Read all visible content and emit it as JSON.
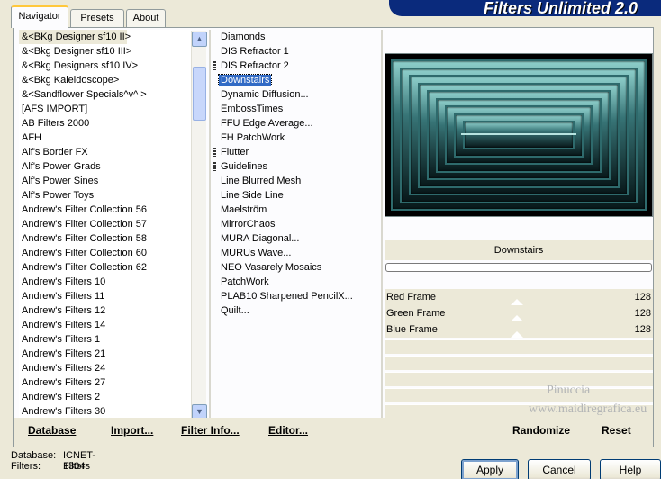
{
  "app": {
    "title": "Filters Unlimited 2.0"
  },
  "tabs": [
    {
      "label": "Navigator"
    },
    {
      "label": "Presets"
    },
    {
      "label": "About"
    }
  ],
  "categories": [
    "&<BKg Designer sf10 II>",
    "&<Bkg Designer sf10 III>",
    "&<Bkg Designers sf10 IV>",
    "&<Bkg Kaleidoscope>",
    "&<Sandflower Specials^v^ >",
    "[AFS IMPORT]",
    "AB Filters 2000",
    "AFH",
    "Alf's Border FX",
    "Alf's Power Grads",
    "Alf's Power Sines",
    "Alf's Power Toys",
    "Andrew's Filter Collection 56",
    "Andrew's Filter Collection 57",
    "Andrew's Filter Collection 58",
    "Andrew's Filter Collection 60",
    "Andrew's Filter Collection 62",
    "Andrew's Filters 10",
    "Andrew's Filters 11",
    "Andrew's Filters 12",
    "Andrew's Filters 14",
    "Andrew's Filters 1",
    "Andrew's Filters 21",
    "Andrew's Filters 24",
    "Andrew's Filters 27",
    "Andrew's Filters 2",
    "Andrew's Filters 30"
  ],
  "filters": [
    {
      "label": "Diamonds"
    },
    {
      "label": "DIS Refractor 1"
    },
    {
      "label": "DIS Refractor 2",
      "grip": true
    },
    {
      "label": "Downstairs",
      "selected": true
    },
    {
      "label": "Dynamic Diffusion..."
    },
    {
      "label": "EmbossTimes"
    },
    {
      "label": "FFU Edge Average..."
    },
    {
      "label": "FH PatchWork"
    },
    {
      "label": "Flutter",
      "grip": true
    },
    {
      "label": "Guidelines",
      "grip": true
    },
    {
      "label": "Line Blurred Mesh"
    },
    {
      "label": "Line Side Line"
    },
    {
      "label": "Maelström"
    },
    {
      "label": "MirrorChaos"
    },
    {
      "label": "MURA Diagonal..."
    },
    {
      "label": "MURUs Wave..."
    },
    {
      "label": "NEO Vasarely Mosaics"
    },
    {
      "label": "PatchWork"
    },
    {
      "label": "PLAB10 Sharpened PencilX..."
    },
    {
      "label": "Quilt..."
    }
  ],
  "preview": {
    "filter_name": "Downstairs",
    "progress": 0
  },
  "controls": [
    {
      "label": "Red Frame",
      "value": "128"
    },
    {
      "label": "Green Frame",
      "value": "128"
    },
    {
      "label": "Blue Frame",
      "value": "128"
    }
  ],
  "watermark": {
    "line1": "Pinuccia",
    "line2": "www.maidiregrafica.eu"
  },
  "buttons": {
    "database": "Database",
    "import": "Import...",
    "filter_info": "Filter Info...",
    "editor": "Editor...",
    "randomize": "Randomize",
    "reset": "Reset",
    "apply": "Apply",
    "cancel": "Cancel",
    "help": "Help"
  },
  "status": {
    "database_label": "Database:",
    "database_value": "ICNET-Filters",
    "filters_label": "Filters:",
    "filters_value": "1304"
  },
  "colors": {
    "selection": "#316ac5",
    "title_bg": "#0a2a7c",
    "preview_teal": "#377476"
  }
}
